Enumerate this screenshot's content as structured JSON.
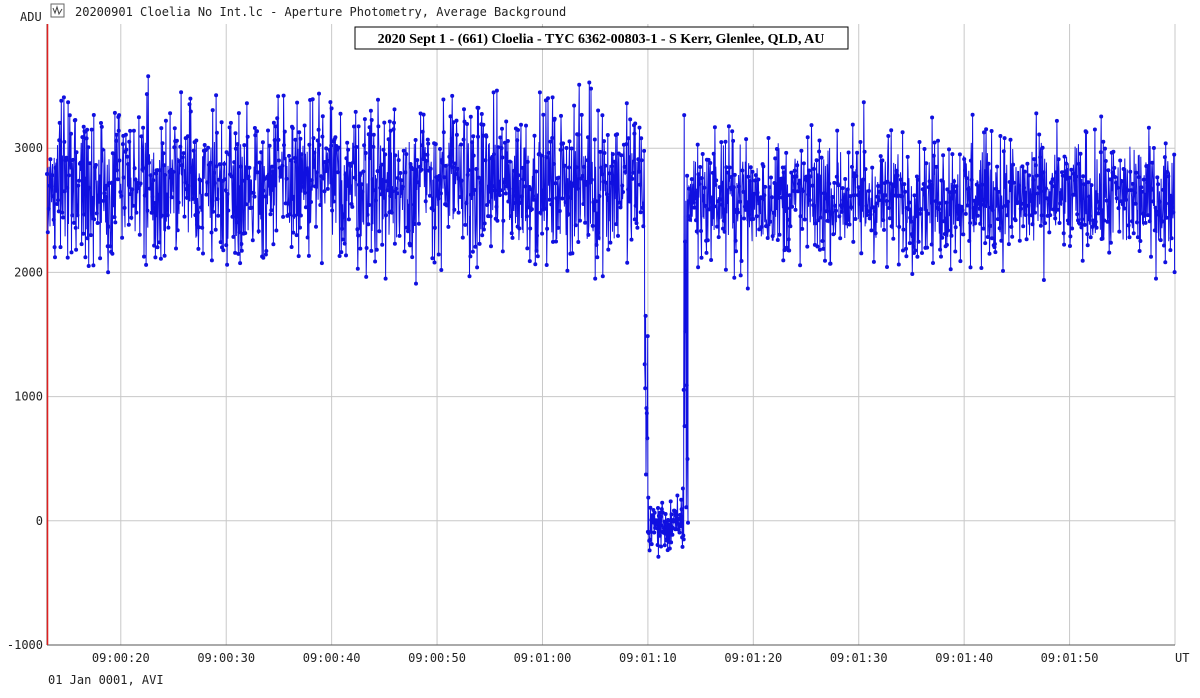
{
  "window": {
    "title": "20200901 Cloelia No Int.lc - Aperture Photometry, Average Background",
    "icon": "lightcurve-icon"
  },
  "footer": {
    "date_label": "01 Jan 0001, AVI"
  },
  "chart_data": {
    "type": "line",
    "title": "2020 Sept 1 - (661) Cloelia - TYC 6362-00803-1 - S Kerr, Glenlee, QLD, AU",
    "xlabel": "UT",
    "ylabel": "ADU",
    "ylim": [
      -1000,
      4000
    ],
    "xlim": [
      0,
      107
    ],
    "y_ticks": [
      -1000,
      0,
      1000,
      2000,
      3000
    ],
    "y_tick_labels": [
      "-1000",
      "0",
      "1000",
      "2000",
      "3000"
    ],
    "x_ticks": [
      7,
      17,
      27,
      37,
      47,
      57,
      67,
      77,
      87,
      97,
      107
    ],
    "x_tick_labels": [
      "09:00:20",
      "09:00:30",
      "09:00:40",
      "09:00:50",
      "09:01:00",
      "09:01:10",
      "09:01:20",
      "09:01:30",
      "09:01:40",
      "09:01:50",
      ""
    ],
    "grid": true,
    "marker_x": 0.05,
    "series_color": "#1010e0",
    "marker_color": "#e02020",
    "series": [
      {
        "segments": [
          {
            "x_start": 0.0,
            "x_end": 56.7,
            "baseline": 2720,
            "scatter": 300
          },
          {
            "x_start": 56.7,
            "x_end": 57.0,
            "baseline": 1000,
            "scatter": 600
          },
          {
            "x_start": 57.0,
            "x_end": 60.4,
            "baseline": -40,
            "scatter": 110
          },
          {
            "x_start": 60.4,
            "x_end": 60.8,
            "baseline": 1500,
            "scatter": 900
          },
          {
            "x_start": 60.8,
            "x_end": 107.0,
            "baseline": 2600,
            "scatter": 240
          }
        ],
        "peaks": [
          {
            "x": 9.6,
            "y": 3580
          },
          {
            "x": 12.7,
            "y": 3450
          },
          {
            "x": 25.8,
            "y": 3440
          },
          {
            "x": 31.4,
            "y": 3390
          },
          {
            "x": 51.6,
            "y": 3480
          },
          {
            "x": 77.5,
            "y": 3370
          },
          {
            "x": 87.8,
            "y": 3270
          },
          {
            "x": 2.0,
            "y": 3370
          },
          {
            "x": 9.4,
            "y": 2060
          },
          {
            "x": 32.1,
            "y": 1950
          },
          {
            "x": 35.0,
            "y": 1910
          },
          {
            "x": 52.0,
            "y": 1950
          },
          {
            "x": 66.5,
            "y": 1870
          },
          {
            "x": 87.6,
            "y": 2040
          },
          {
            "x": 40.8,
            "y": 2040
          },
          {
            "x": 57.1,
            "y": -160
          },
          {
            "x": 59.0,
            "y": -170
          },
          {
            "x": 60.3,
            "y": 260
          }
        ]
      }
    ]
  }
}
